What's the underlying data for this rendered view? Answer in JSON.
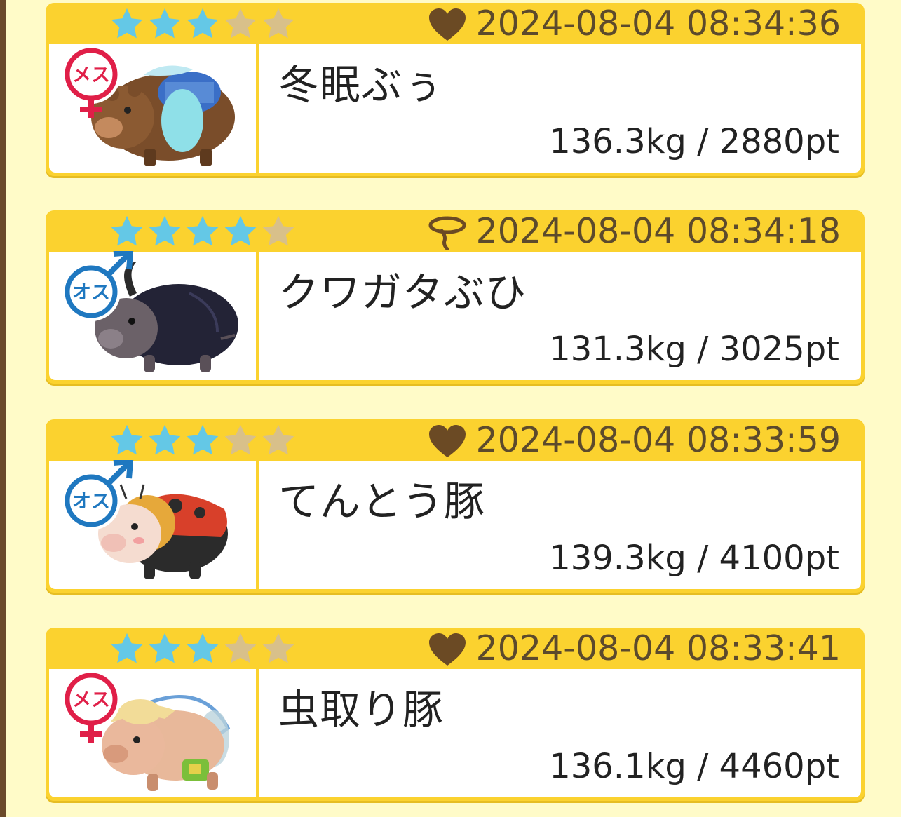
{
  "colors": {
    "card": "#fbd22f",
    "star_on": "#64c8e6",
    "star_off": "#d8c08a",
    "timestamp": "#5c4a2c",
    "female": "#e01f48",
    "male": "#1f78c0",
    "heart": "#6b4a24"
  },
  "entries": [
    {
      "gender": {
        "label": "メス",
        "icon": "female-symbol-icon"
      },
      "rating": 3,
      "max_rating": 5,
      "status_icon": "heart-icon",
      "timestamp": "2024-08-04 08:34:36",
      "name": "冬眠ぶぅ",
      "stats": "136.3kg / 2880pt",
      "portrait": "sleeping-bear-pig-icon"
    },
    {
      "gender": {
        "label": "オス",
        "icon": "male-symbol-icon"
      },
      "rating": 4,
      "max_rating": 5,
      "status_icon": "lasso-icon",
      "timestamp": "2024-08-04 08:34:18",
      "name": "クワガタぶひ",
      "stats": "131.3kg / 3025pt",
      "portrait": "stag-beetle-pig-icon"
    },
    {
      "gender": {
        "label": "オス",
        "icon": "male-symbol-icon"
      },
      "rating": 3,
      "max_rating": 5,
      "status_icon": "heart-icon",
      "timestamp": "2024-08-04 08:33:59",
      "name": "てんとう豚",
      "stats": "139.3kg / 4100pt",
      "portrait": "ladybug-pig-icon"
    },
    {
      "gender": {
        "label": "メス",
        "icon": "female-symbol-icon"
      },
      "rating": 3,
      "max_rating": 5,
      "status_icon": "heart-icon",
      "timestamp": "2024-08-04 08:33:41",
      "name": "虫取り豚",
      "stats": "136.1kg / 4460pt",
      "portrait": "bug-catcher-pig-icon"
    }
  ]
}
